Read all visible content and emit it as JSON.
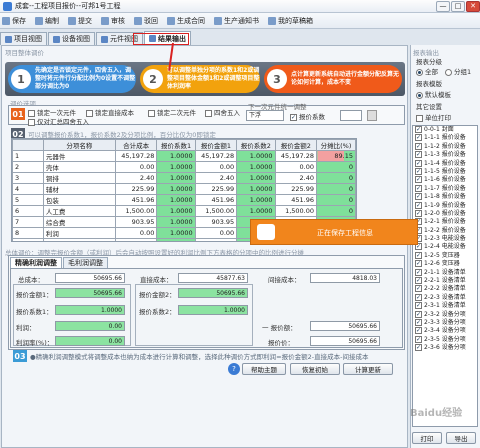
{
  "window": {
    "title": "成套--工程项目报价--可邦1号工程",
    "min": "—",
    "max": "□",
    "close": "✕"
  },
  "toolbar": [
    "保存",
    "编制",
    "提交",
    "审核",
    "驳回",
    "生成合同",
    "生产通知书",
    "我的草稿箱"
  ],
  "tabs": [
    "项目视图",
    "设备视图",
    "元件视图",
    "结果输出"
  ],
  "section_title": "项目整体调价",
  "steps": [
    {
      "num": "1",
      "text": "先确定是否锁定元件，四舍五入，调整时将元件行分配比例为0设置不调整部分调比为0"
    },
    {
      "num": "2",
      "text": "可以调整单独分项的系数1和2或调整项目整体金额1和2或调整项目整体利润率"
    },
    {
      "num": "3",
      "text": "点计算更新系统自动进行金额分配反算无论如何计算，成本不变"
    }
  ],
  "options": {
    "label": "调价选项",
    "badge": "01",
    "checks": [
      "锁定一次元件",
      "锁定直接成本",
      "锁定二次元件",
      "四舍五入",
      "仅对汇总四舍五入"
    ],
    "lower_label": "下一次元件统一调整",
    "lower_value": "下浮",
    "factor_label": "报价系数"
  },
  "table": {
    "badge": "02",
    "hint": "可以调整报价系数1，报价系数2及分项比例，百分比仅为0即锁定",
    "headers": [
      "",
      "分项名称",
      "合计成本",
      "报价系数1",
      "报价金额1",
      "报价系数2",
      "报价金额2",
      "分摊比(%)"
    ],
    "rows": [
      [
        "1",
        "元器件",
        "45,197.28",
        "1.0000",
        "45,197.28",
        "1.0000",
        "45,197.28",
        "89.15"
      ],
      [
        "2",
        "壳体",
        "0.00",
        "1.0000",
        "0.00",
        "1.0000",
        "0.00",
        "0"
      ],
      [
        "3",
        "铜排",
        "2.40",
        "1.0000",
        "2.40",
        "1.0000",
        "2.40",
        "0"
      ],
      [
        "4",
        "辅材",
        "225.99",
        "1.0000",
        "225.99",
        "1.0000",
        "225.99",
        "0"
      ],
      [
        "5",
        "包装",
        "451.96",
        "1.0000",
        "451.96",
        "1.0000",
        "451.96",
        "0"
      ],
      [
        "6",
        "人工费",
        "1,500.00",
        "1.0000",
        "1,500.00",
        "1.0000",
        "1,500.00",
        "0"
      ],
      [
        "7",
        "综合费",
        "903.95",
        "1.0000",
        "903.95",
        "1.0000",
        "903.95",
        "0"
      ],
      [
        "8",
        "利润",
        "0.00",
        "1.0000",
        "0.00",
        "1.0000",
        "0.00",
        "0"
      ],
      [
        "20",
        "合计:",
        "",
        "",
        "",
        "",
        "",
        ""
      ]
    ]
  },
  "overall": {
    "title": "总体调价：调整完报价金额（或利润）后会自动按照设置好的利润比例下方表格的分项中的比例进行分摊",
    "tabs": [
      "精确利润调整",
      "毛利润调整"
    ],
    "total_cost_label": "总成本：",
    "total_cost": "50695.66",
    "direct_cost_label": "直接成本：",
    "direct_cost": "45877.63",
    "indirect_cost_label": "间接成本：",
    "indirect_cost": "4818.03",
    "amount1_label": "报价金额1：",
    "amount1": "50695.66",
    "amount2_label": "报价金额2：",
    "amount2": "50695.66",
    "factor1_label": "报价系数1：",
    "factor1": "1.0000",
    "factor2_label": "报价系数2：",
    "factor2": "1.0000",
    "profit_label": "利润：",
    "profit": "0.00",
    "profit_rate_label": "利润率(%)：",
    "profit_rate": "0.00",
    "extra_label": "一 报价额：",
    "extra": "50695.66",
    "price_label": "报价价：",
    "price": "50695.66",
    "badge": "03",
    "note": "●精确利润调整模式将调整成本也纳为成本进行计算和调整，选择此种调价方式即利润=报价金额2-直接成本-间接成本"
  },
  "buttons": {
    "help": "帮助主题",
    "reset": "恢复初始",
    "calc": "计算更新"
  },
  "right": {
    "title": "报表输出",
    "group": "报表分级",
    "radios": [
      "全部",
      "分组1"
    ],
    "items_label": "报表模版",
    "sel": "默认模板",
    "other": "其它设置",
    "single": "单位打印",
    "tree": [
      "0-0-1 封面",
      "1-1-1 报价设备",
      "1-1-2 报价设备",
      "1-1-3 报价设备",
      "1-1-4 报价设备",
      "1-1-5 报价设备",
      "1-1-6 报价设备",
      "1-1-7 报价设备",
      "1-1-8 报价设备",
      "1-1-9 报价设备",
      "1-2-0 报价设备",
      "1-2-1 报价设备",
      "1-2-2 报价设备",
      "1-2-3 电能设备",
      "1-2-4 电能设备",
      "1-2-5 变压器",
      "1-2-6 变压器",
      "2-1-1 设备清单",
      "2-2-1 设备清单",
      "2-2-2 设备清单",
      "2-2-3 设备清单",
      "2-3-1 设备清单",
      "2-3-2 设备分项",
      "2-3-3 设备分项",
      "2-3-4 设备分项",
      "2-3-5 设备分项",
      "2-3-6 设备分项"
    ],
    "print": "打印",
    "export": "导出"
  },
  "toast": {
    "text": "正在保存工程信息"
  },
  "watermark": "Baidu经验"
}
